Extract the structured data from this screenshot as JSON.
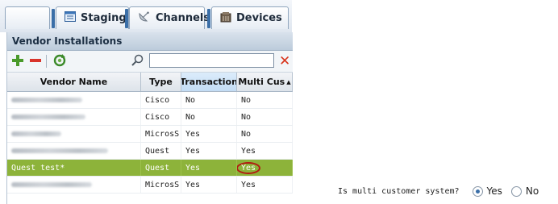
{
  "tabs": [
    {
      "label": "",
      "icon": "none"
    },
    {
      "label": "Staging",
      "icon": "staging-icon"
    },
    {
      "label": "Channels",
      "icon": "satellite-dish-icon"
    },
    {
      "label": "Devices",
      "icon": "devices-icon"
    }
  ],
  "panel": {
    "title": "Vendor Installations",
    "search": {
      "value": "",
      "placeholder": ""
    }
  },
  "grid": {
    "columns": [
      "Vendor Name",
      "Type",
      "Transaction",
      "Multi Cus"
    ],
    "sort_indicator": "▲",
    "rows": [
      {
        "name": "",
        "type": "Cisco",
        "transaction": "No",
        "multi": "No"
      },
      {
        "name": "",
        "type": "Cisco",
        "transaction": "No",
        "multi": "No"
      },
      {
        "name": "",
        "type": "MicrosS",
        "transaction": "Yes",
        "multi": "No"
      },
      {
        "name": "",
        "type": "Quest",
        "transaction": "Yes",
        "multi": "Yes"
      },
      {
        "name": "Quest test*",
        "type": "Quest",
        "transaction": "Yes",
        "multi": "Yes"
      },
      {
        "name": "",
        "type": "MicrosS",
        "transaction": "Yes",
        "multi": "Yes"
      }
    ]
  },
  "question": {
    "label": "Is multi customer system?",
    "options": [
      "Yes",
      "No"
    ],
    "selected": "Yes"
  },
  "colors": {
    "selected_row": "#8db33a",
    "accent_blue": "#3b6fa8",
    "highlight_circle": "#b21a12"
  }
}
